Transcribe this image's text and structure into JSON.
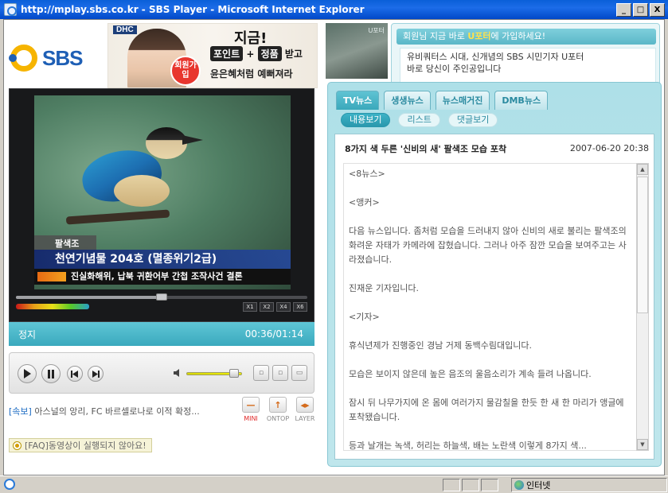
{
  "window": {
    "title": "http://mplay.sbs.co.kr - SBS Player - Microsoft Internet Explorer",
    "min": "_",
    "max": "□",
    "close": "X"
  },
  "logo": {
    "text": "SBS"
  },
  "ad": {
    "brand": "DHC",
    "badge": "회원가입",
    "headline": "지금!",
    "point": "포인트",
    "plus": "+",
    "product": "정품",
    "suffix": "받고",
    "tagline": "윤은혜처럼 예뻐져라"
  },
  "video": {
    "caption_small": "팔색조",
    "caption_big": "천연기념물 204호 (멸종위기2급)",
    "ticker": "진실화해위, 납북 귀환어부 간첩 조작사건 결론",
    "speeds": [
      "X1",
      "X2",
      "X4",
      "X6"
    ],
    "progress": 0.5
  },
  "status": {
    "state": "정지",
    "time": "00:36/01:14"
  },
  "controls": {
    "volume": 0.85
  },
  "news": {
    "tag": "[속보]",
    "text": "아스널의 앙리, FC 바르셀로나로 이적 확정..."
  },
  "modes": [
    {
      "label": "MINI",
      "icon": "minimize-icon",
      "glyph": "—"
    },
    {
      "label": "ONTOP",
      "icon": "arrow-up-icon",
      "glyph": "↑"
    },
    {
      "label": "LAYER",
      "icon": "layer-icon",
      "glyph": "◂▸"
    }
  ],
  "faq": {
    "text": "[FAQ]동영상이 실행되지 않아요!"
  },
  "promo": {
    "head_user": "회원님 지금 바로 ",
    "head_highlight": "U포터",
    "head_suffix": "에 가입하세요!",
    "body_line1": "유비쿼터스 시대, 신개념의 SBS 시민기자 U포터",
    "body_line2": "바로 당신이 주인공입니다",
    "thumb_label": "U포터"
  },
  "tabs": [
    "TV뉴스",
    "생생뉴스",
    "뉴스매거진",
    "DMB뉴스"
  ],
  "active_tab": 0,
  "subtabs": [
    "내용보기",
    "리스트",
    "댓글보기"
  ],
  "active_subtab": 0,
  "article": {
    "title": "8가지 색 두른 '신비의 새' 팔색조 모습 포착",
    "date": "2007-06-20 20:38",
    "paragraphs": [
      "<8뉴스>",
      "<앵커>",
      "다음 뉴스입니다. 좀처럼 모습을 드러내지 않아 신비의 새로 불리는 팔색조의 화려운 자태가 카메라에 잡혔습니다. 그러나 아주 잠깐 모습을 보여주고는 사라졌습니다.",
      "진재운 기자입니다.",
      "<기자>",
      "휴식년제가 진행중인 경남 거제 동백수림대입니다.",
      "모습은 보이지 않은데 높은 음조의 울음소리가 계속 들려 나옵니다.",
      "잠시 뒤 나무가지에 온 몸에 여러가지 물감칠을 한듯 한 새 한 마리가 앵글에 포착됐습니다.",
      "등과 날개는 녹색, 허리는 하늘색, 배는 노란색 이렇게 8가지 색..."
    ]
  },
  "iestatus": {
    "zone": "인터넷"
  },
  "colors": {
    "accent": "#3aa9bd",
    "brand_blue": "#1e5fb5",
    "brand_yellow": "#f6b400"
  }
}
